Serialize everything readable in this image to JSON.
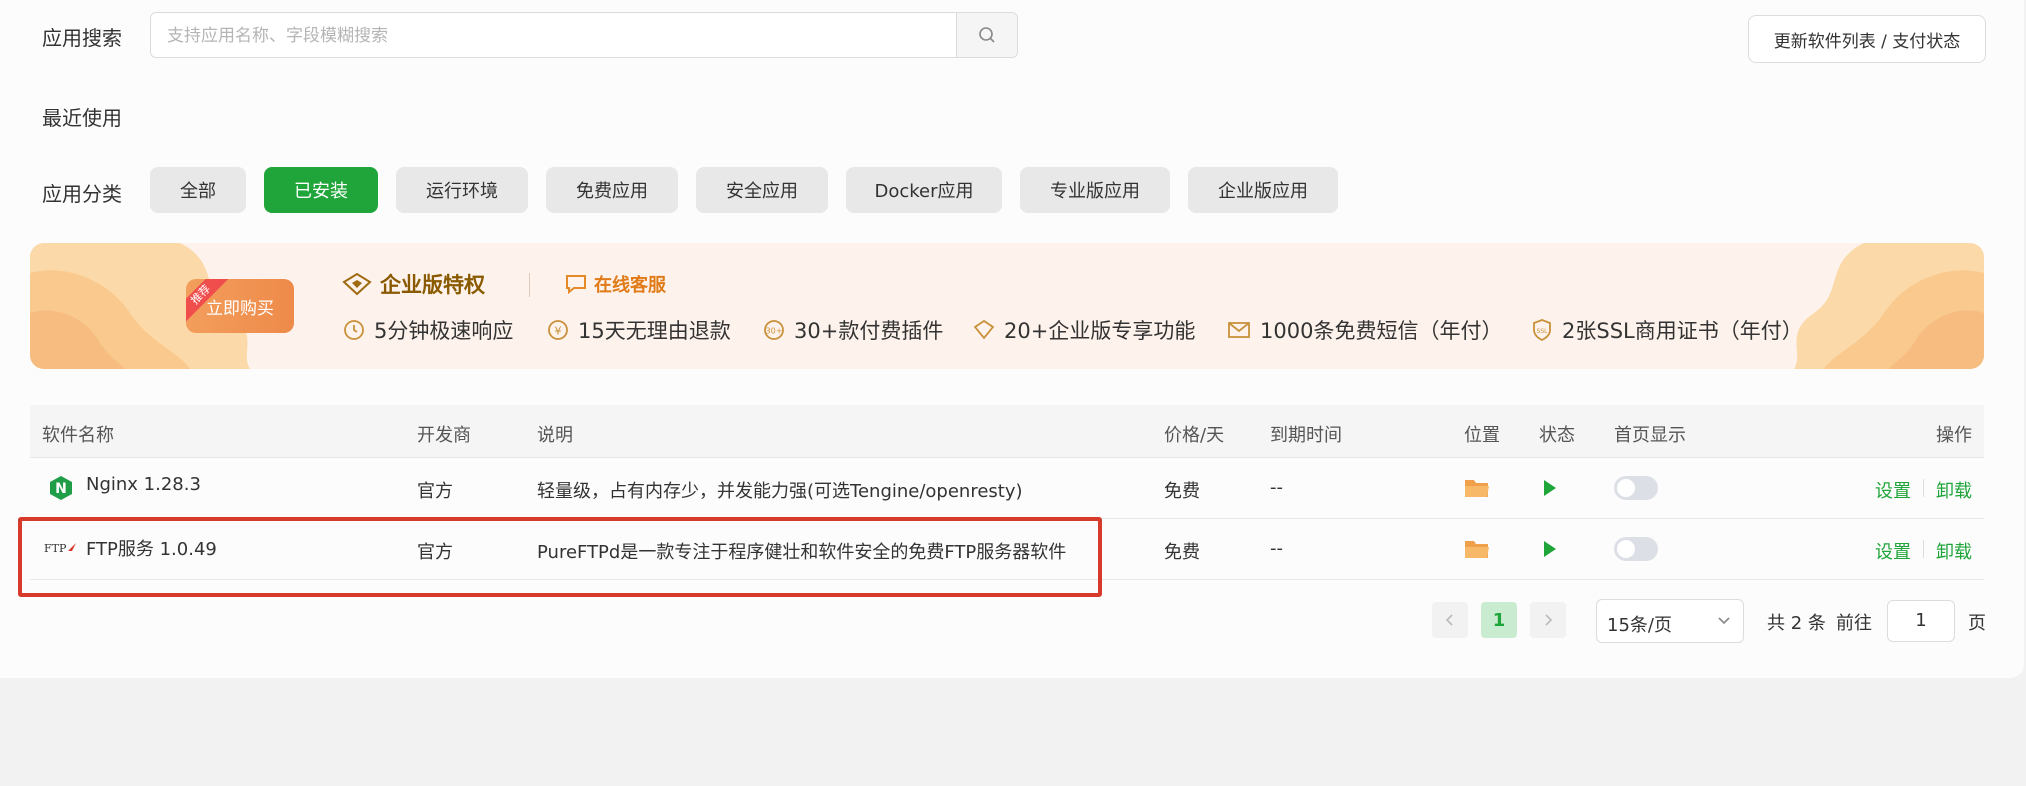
{
  "search": {
    "label": "应用搜索",
    "placeholder": "支持应用名称、字段模糊搜索",
    "update_button": "更新软件列表 / 支付状态"
  },
  "recent": {
    "label": "最近使用"
  },
  "categories": {
    "label": "应用分类",
    "items": [
      "全部",
      "已安装",
      "运行环境",
      "免费应用",
      "安全应用",
      "Docker应用",
      "专业版应用",
      "企业版应用"
    ],
    "active": "已安装"
  },
  "banner": {
    "badge": "推荐",
    "buy_label": "立即购买",
    "title": "企业版特权",
    "service": "在线客服",
    "features": [
      "5分钟极速响应",
      "15天无理由退款",
      "30+款付费插件",
      "20+企业版专享功能",
      "1000条免费短信（年付）",
      "2张SSL商用证书（年付）"
    ],
    "icon_texts": {
      "money": "¥",
      "plugins": "30+",
      "ssl": "SSL"
    }
  },
  "table": {
    "columns": [
      "软件名称",
      "开发商",
      "说明",
      "价格/天",
      "到期时间",
      "位置",
      "状态",
      "首页显示",
      "操作"
    ],
    "rows": [
      {
        "icon": "nginx-icon",
        "icon_text": "N",
        "name": "Nginx 1.28.3",
        "developer": "官方",
        "description": "轻量级，占有内存少，并发能力强(可选Tengine/openresty)",
        "price": "免费",
        "expiry": "--",
        "homepage_display": false,
        "actions": [
          "设置",
          "卸载"
        ]
      },
      {
        "icon": "ftp-icon",
        "icon_text": "FTP",
        "name": "FTP服务 1.0.49",
        "developer": "官方",
        "description": "PureFTPd是一款专注于程序健壮和软件安全的免费FTP服务器软件",
        "price": "免费",
        "expiry": "--",
        "homepage_display": false,
        "actions": [
          "设置",
          "卸载"
        ]
      }
    ]
  },
  "pagination": {
    "current_page": "1",
    "per_page": "15条/页",
    "total": "共 2 条",
    "goto_label": "前往",
    "goto_value": "1",
    "page_suffix": "页"
  },
  "colors": {
    "accent": "#20a53a",
    "highlight": "#d63a2a",
    "banner_orange": "#ee8a4a"
  }
}
